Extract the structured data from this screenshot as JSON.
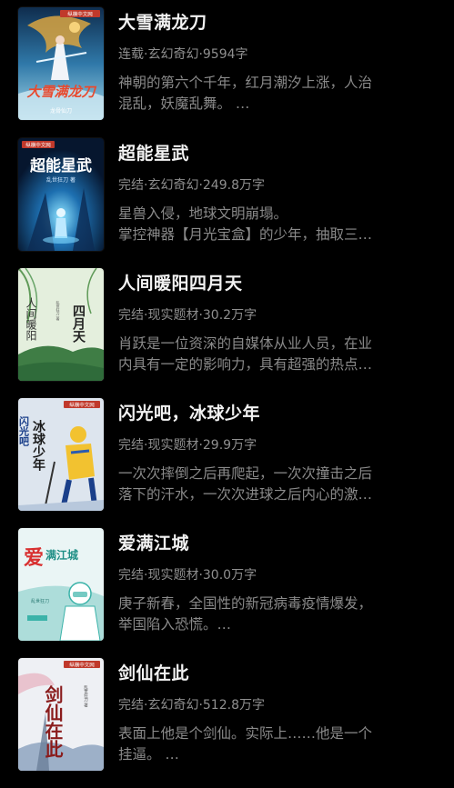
{
  "books": [
    {
      "title": "大雪满龙刀",
      "meta": "连载·玄幻奇幻·9594字",
      "desc": [
        "神朝的第六个千年，红月潮汐上涨，人治",
        "混乱，妖魔乱舞。 …"
      ],
      "cover": {
        "text": "大雪满龙刀",
        "publisher": "纵横中文网",
        "author": "龙骨仙刀",
        "colors": [
          "#1e4d7a",
          "#7ac0d8",
          "#e0a040"
        ],
        "icon": "dragon-swordsman-cover-art"
      }
    },
    {
      "title": "超能星武",
      "meta": "完结·玄幻奇幻·249.8万字",
      "desc": [
        "星兽入侵，地球文明崩塌。",
        "掌控神器【月光宝盒】的少年，抽取三…"
      ],
      "cover": {
        "text": "超能星武",
        "publisher": "纵横中文网",
        "author": "乱世狂刀 著",
        "colors": [
          "#0a1e3c",
          "#1d6fb0",
          "#7fd8ff"
        ],
        "icon": "glowing-figure-cover-art"
      }
    },
    {
      "title": "人间暖阳四月天",
      "meta": "完结·现实题材·30.2万字",
      "desc": [
        "肖跃是一位资深的自媒体从业人员，在业",
        "内具有一定的影响力，具有超强的热点…"
      ],
      "cover": {
        "text1": "人间暖阳",
        "text2": "四月天",
        "author": "乱世狂刀 著",
        "colors": [
          "#c9e2c0",
          "#6aa56a",
          "#2f6b3a"
        ],
        "icon": "willow-landscape-cover-art"
      }
    },
    {
      "title": "闪光吧，冰球少年",
      "meta": "完结·现实题材·29.9万字",
      "desc": [
        "一次次摔倒之后再爬起，一次次撞击之后",
        "落下的汗水，一次次进球之后内心的激…"
      ],
      "cover": {
        "text1": "闪光吧",
        "text2": "冰球少年",
        "publisher": "纵横中文网",
        "author": "乱世狂刀 著",
        "colors": [
          "#dfe6ef",
          "#2a5bb0",
          "#f2c230"
        ],
        "icon": "hockey-player-cover-art"
      }
    },
    {
      "title": "爱满江城",
      "meta": "完结·现实题材·30.0万字",
      "desc": [
        "庚子新春，全国性的新冠病毒疫情爆发，",
        "举国陷入恐慌。…"
      ],
      "cover": {
        "text1": "爱",
        "text2": "满江城",
        "author": "乱世狂刀",
        "colors": [
          "#e9f4f4",
          "#2aa8a0",
          "#d83030"
        ],
        "icon": "medical-worker-cover-art"
      }
    },
    {
      "title": "剑仙在此",
      "meta": "完结·玄幻奇幻·512.8万字",
      "desc": [
        "表面上他是个剑仙。实际上……他是一个",
        "挂逼。 …"
      ],
      "cover": {
        "text": "剑仙在此",
        "publisher": "纵横中文网",
        "author": "乱世狂刀 著",
        "colors": [
          "#eef0f4",
          "#9db0c8",
          "#8a1c1c"
        ],
        "icon": "sword-immortal-cover-art"
      }
    }
  ]
}
